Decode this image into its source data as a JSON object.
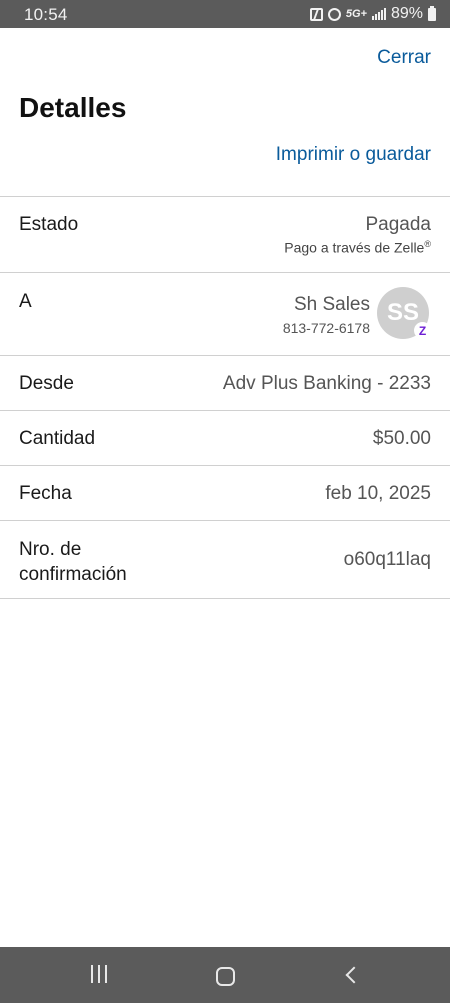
{
  "status_bar": {
    "time": "10:54",
    "network": "5G+",
    "battery": "89%"
  },
  "header": {
    "close_label": "Cerrar",
    "title": "Detalles",
    "print_label": "Imprimir o guardar"
  },
  "details": {
    "estado": {
      "label": "Estado",
      "value": "Pagada",
      "sub": "Pago a través de Zelle",
      "sub_mark": "®"
    },
    "a": {
      "label": "A",
      "name": "Sh Sales",
      "phone": "813-772-6178",
      "initials": "SS",
      "badge": "Z"
    },
    "desde": {
      "label": "Desde",
      "value": "Adv Plus Banking - 2233"
    },
    "cantidad": {
      "label": "Cantidad",
      "value": "$50.00"
    },
    "fecha": {
      "label": "Fecha",
      "value": "feb 10, 2025"
    },
    "confirmacion": {
      "label": "Nro. de confirmación",
      "value": "o60q11laq"
    }
  },
  "colors": {
    "link": "#0a5b9b",
    "system_bar": "#5b5b5b",
    "avatar": "#cfcfcf",
    "zelle": "#6d1ed4"
  },
  "icons": {
    "nfc": "nfc-icon",
    "alarm": "alarm-icon",
    "signal": "signal-icon",
    "battery": "battery-icon",
    "zelle_badge": "zelle-icon",
    "recents": "recents-icon",
    "home": "home-icon",
    "back": "back-icon"
  }
}
